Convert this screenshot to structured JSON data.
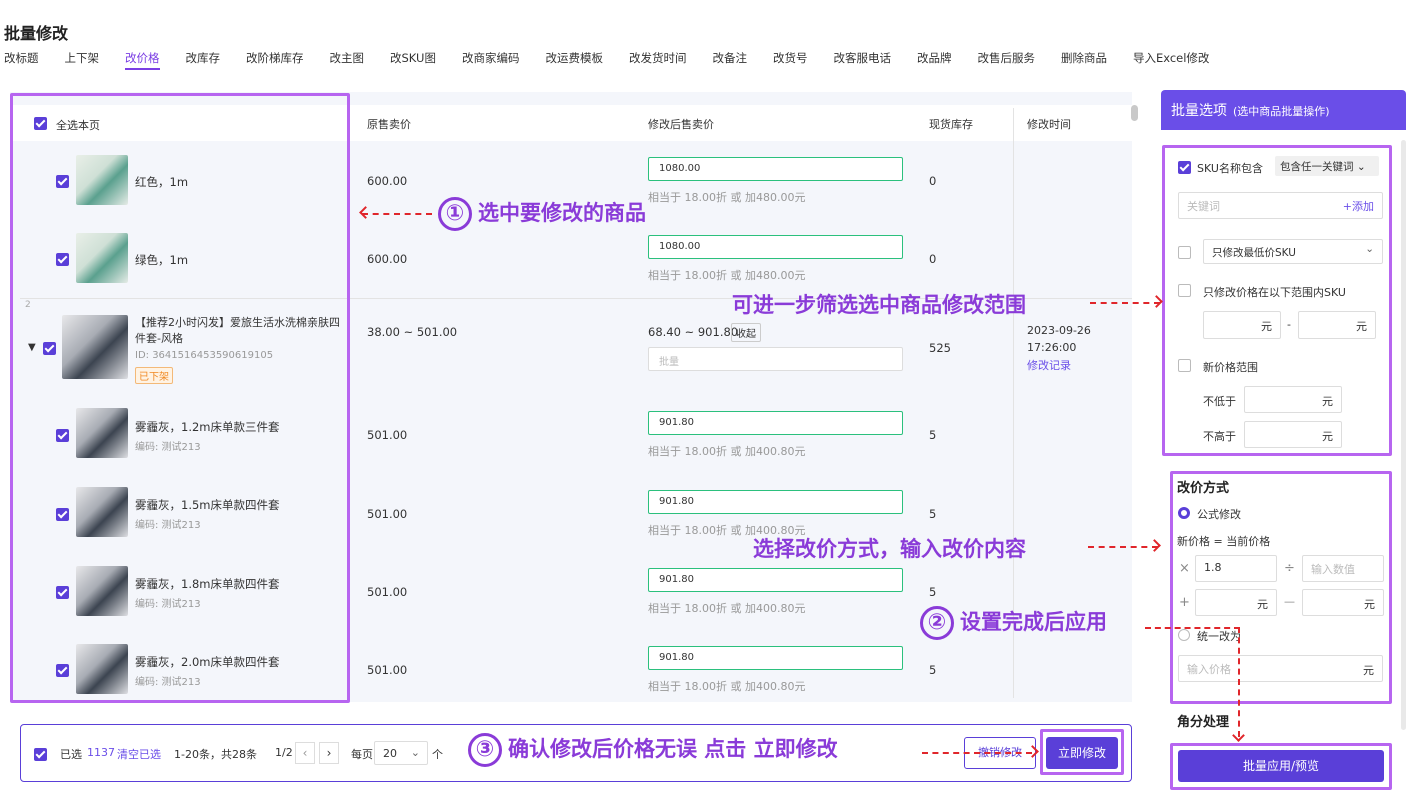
{
  "page": {
    "title": "批量修改"
  },
  "tabs": [
    "改标题",
    "上下架",
    "改价格",
    "改库存",
    "改阶梯库存",
    "改主图",
    "改SKU图",
    "改商家编码",
    "改运费模板",
    "改发货时间",
    "改备注",
    "改货号",
    "改客服电话",
    "改品牌",
    "改售后服务",
    "删除商品",
    "导入Excel修改"
  ],
  "table": {
    "select_all_label": "全选本页",
    "headers": {
      "orig_price": "原售卖价",
      "new_price": "修改后售卖价",
      "stock": "现货库存",
      "modified_time": "修改时间"
    },
    "rows": [
      {
        "name": "红色，1m",
        "orig_price": "600.00",
        "new_price": "1080.00",
        "hint": "相当于 18.00折 或 加480.00元",
        "stock": "0"
      },
      {
        "name": "绿色，1m",
        "orig_price": "600.00",
        "new_price": "1080.00",
        "hint": "相当于 18.00折 或 加480.00元",
        "stock": "0"
      }
    ],
    "product": {
      "index": "2",
      "name_line1": "【推荐2小时闪发】爱旅生活水洗棉亲肤四",
      "name_line2": "件套-风格",
      "id": "ID: 3641516453590619105",
      "status": "已下架",
      "orig_price": "38.00 ~ 501.00",
      "new_price_range": "68.40 ~ 901.80",
      "collapse_label": "收起",
      "batch_placeholder": "批量",
      "stock": "525",
      "modified_date": "2023-09-26",
      "modified_time": "17:26:00",
      "history_link": "修改记录"
    },
    "sku_rows": [
      {
        "name": "雾霾灰，1.2m床单款三件套",
        "code": "编码: 测试213",
        "orig_price": "501.00",
        "new_price": "901.80",
        "hint": "相当于 18.00折 或 加400.80元",
        "stock": "5"
      },
      {
        "name": "雾霾灰，1.5m床单款四件套",
        "code": "编码: 测试213",
        "orig_price": "501.00",
        "new_price": "901.80",
        "hint": "相当于 18.00折 或 加400.80元",
        "stock": "5"
      },
      {
        "name": "雾霾灰，1.8m床单款四件套",
        "code": "编码: 测试213",
        "orig_price": "501.00",
        "new_price": "901.80",
        "hint": "相当于 18.00折 或 加400.80元",
        "stock": "5"
      },
      {
        "name": "雾霾灰，2.0m床单款四件套",
        "code": "编码: 测试213",
        "orig_price": "501.00",
        "new_price": "901.80",
        "hint": "相当于 18.00折 或 加400.80元",
        "stock": "5"
      }
    ]
  },
  "footer": {
    "selected_label": "已选",
    "selected_count": "1137",
    "clear_label": "清空已选",
    "range_text": "1-20条，共28条",
    "page_text": "1/2",
    "per_page_label": "每页",
    "per_page_value": "20",
    "unit": "个",
    "undo_label": "撤销修改",
    "apply_now_label": "立即修改"
  },
  "sidebar": {
    "title": "批量选项",
    "subtitle": "(选中商品批量操作)",
    "sku_name_contains": "SKU名称包含",
    "keyword_mode": "包含任一关键词",
    "keyword_placeholder": "关键词",
    "add_label": "+添加",
    "lowest_sku_select": "只修改最低价SKU",
    "price_range_label": "只修改价格在以下范围内SKU",
    "yuan": "元",
    "dash": "-",
    "new_price_range_label": "新价格范围",
    "not_lower": "不低于",
    "not_higher": "不高于",
    "method_title": "改价方式",
    "formula_label": "公式修改",
    "formula_desc": "新价格 = 当前价格",
    "times_symbol": "×",
    "multiplier": "1.8",
    "divide_symbol": "÷",
    "value_placeholder": "输入数值",
    "plus_symbol": "+",
    "minus_symbol": "—",
    "uniform_label": "统一改为",
    "price_placeholder": "输入价格",
    "rounding_title": "角分处理",
    "apply_button": "批量应用/预览"
  },
  "annotations": {
    "a1_num": "①",
    "a1_text": "选中要修改的商品",
    "a_filter": "可进一步筛选选中商品修改范围",
    "a_method": "选择改价方式，输入改价内容",
    "a2_num": "②",
    "a2_text": "设置完成后应用",
    "a3_num": "③",
    "a3_text": "确认修改后价格无误 点击 立即修改"
  }
}
